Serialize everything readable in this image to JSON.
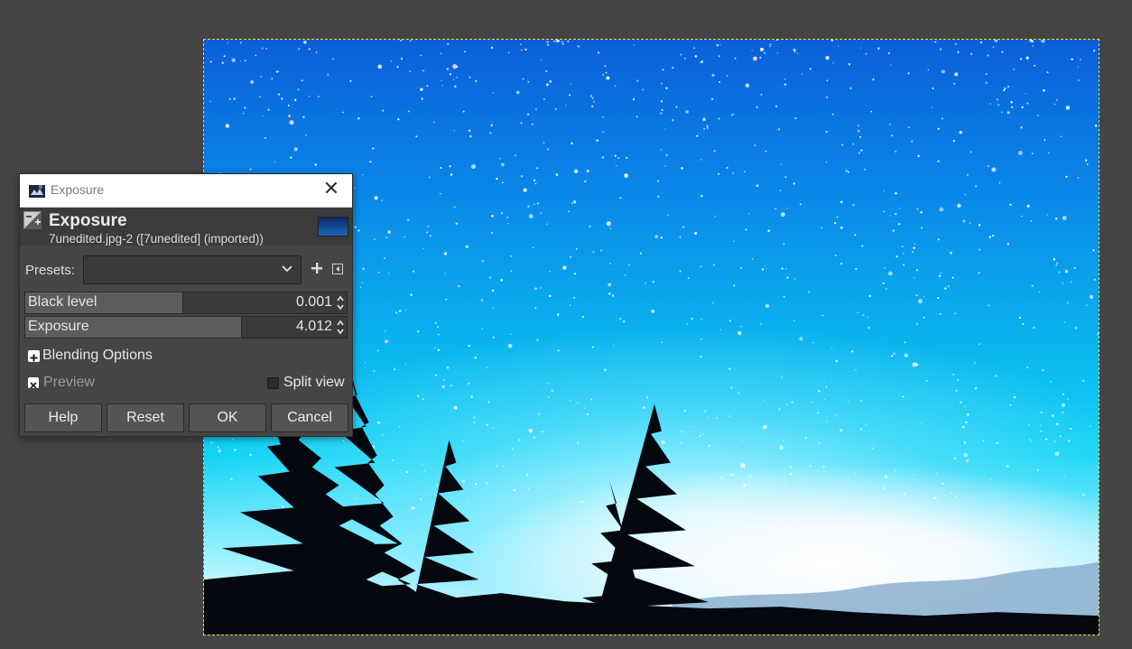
{
  "dialog": {
    "window_title": "Exposure",
    "header_title": "Exposure",
    "header_subtitle": "7unedited.jpg-2 ([7unedited] (imported))",
    "presets_label": "Presets:",
    "presets_value": "",
    "sliders": [
      {
        "label": "Black level",
        "value": "0.001",
        "fill_fraction": 0.49
      },
      {
        "label": "Exposure",
        "value": "4.012",
        "fill_fraction": 0.67
      }
    ],
    "blending_options_label": "Blending Options",
    "preview_label": "Preview",
    "preview_checked": true,
    "split_view_label": "Split view",
    "split_view_checked": false,
    "buttons": {
      "help": "Help",
      "reset": "Reset",
      "ok": "OK",
      "cancel": "Cancel"
    }
  },
  "icons": {
    "window_icon": "gimp-wilber-icon",
    "tool_icon": "exposure-icon",
    "close_icon": "close-icon",
    "dropdown_icon": "chevron-down-icon",
    "add_preset_icon": "plus-icon",
    "preset_menu_icon": "menu-left-arrow-icon"
  },
  "colors": {
    "workspace_bg": "#454545",
    "dialog_bg": "#454545",
    "selection_border": "#e6d84a"
  }
}
